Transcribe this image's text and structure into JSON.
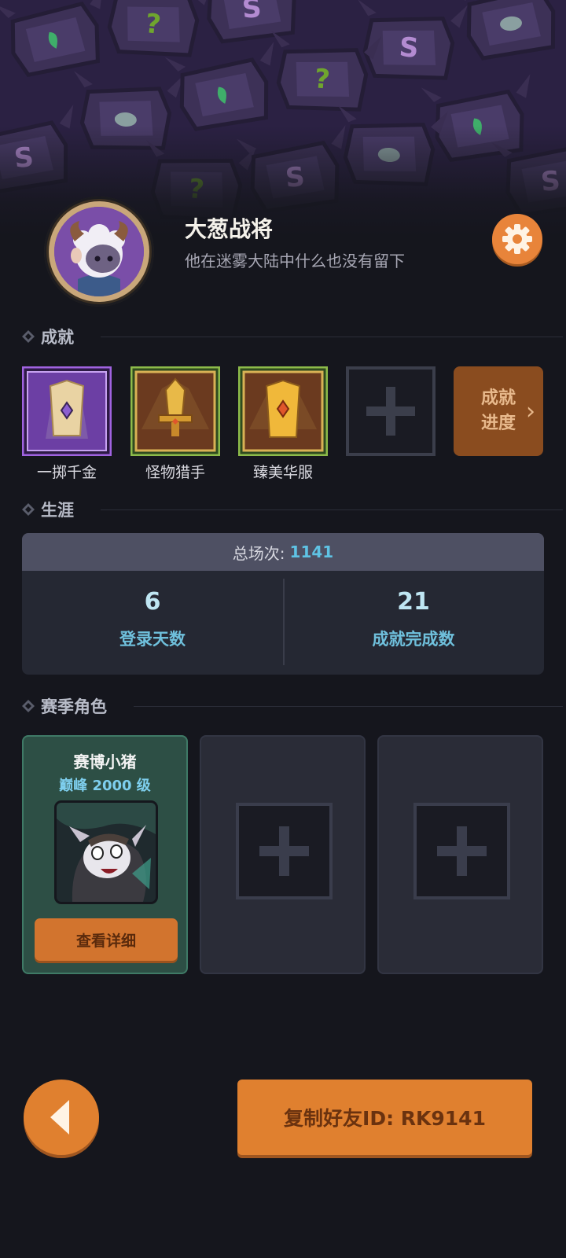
{
  "profile": {
    "name": "大葱战将",
    "bio": "他在迷雾大陆中什么也没有留下"
  },
  "sections": {
    "achievements": "成就",
    "career": "生涯",
    "season_characters": "赛季角色"
  },
  "achievements": [
    {
      "label": "一掷千金",
      "frame": "purple"
    },
    {
      "label": "怪物猎手",
      "frame": "green"
    },
    {
      "label": "臻美华服",
      "frame": "green"
    }
  ],
  "achievement_progress": {
    "line1": "成就",
    "line2": "进度",
    "chevron": "›"
  },
  "career": {
    "total_label": "总场次:",
    "total_value": "1141",
    "stats": [
      {
        "value": "6",
        "label": "登录天数"
      },
      {
        "value": "21",
        "label": "成就完成数"
      }
    ]
  },
  "season_characters": [
    {
      "name": "赛博小猪",
      "level": "巅峰 2000 级",
      "button": "查看详细"
    }
  ],
  "footer": {
    "copy_button": "复制好友ID: RK9141"
  },
  "colors": {
    "accent": "#e0802f",
    "highlight": "#5fc3e4",
    "background": "#15161d"
  }
}
